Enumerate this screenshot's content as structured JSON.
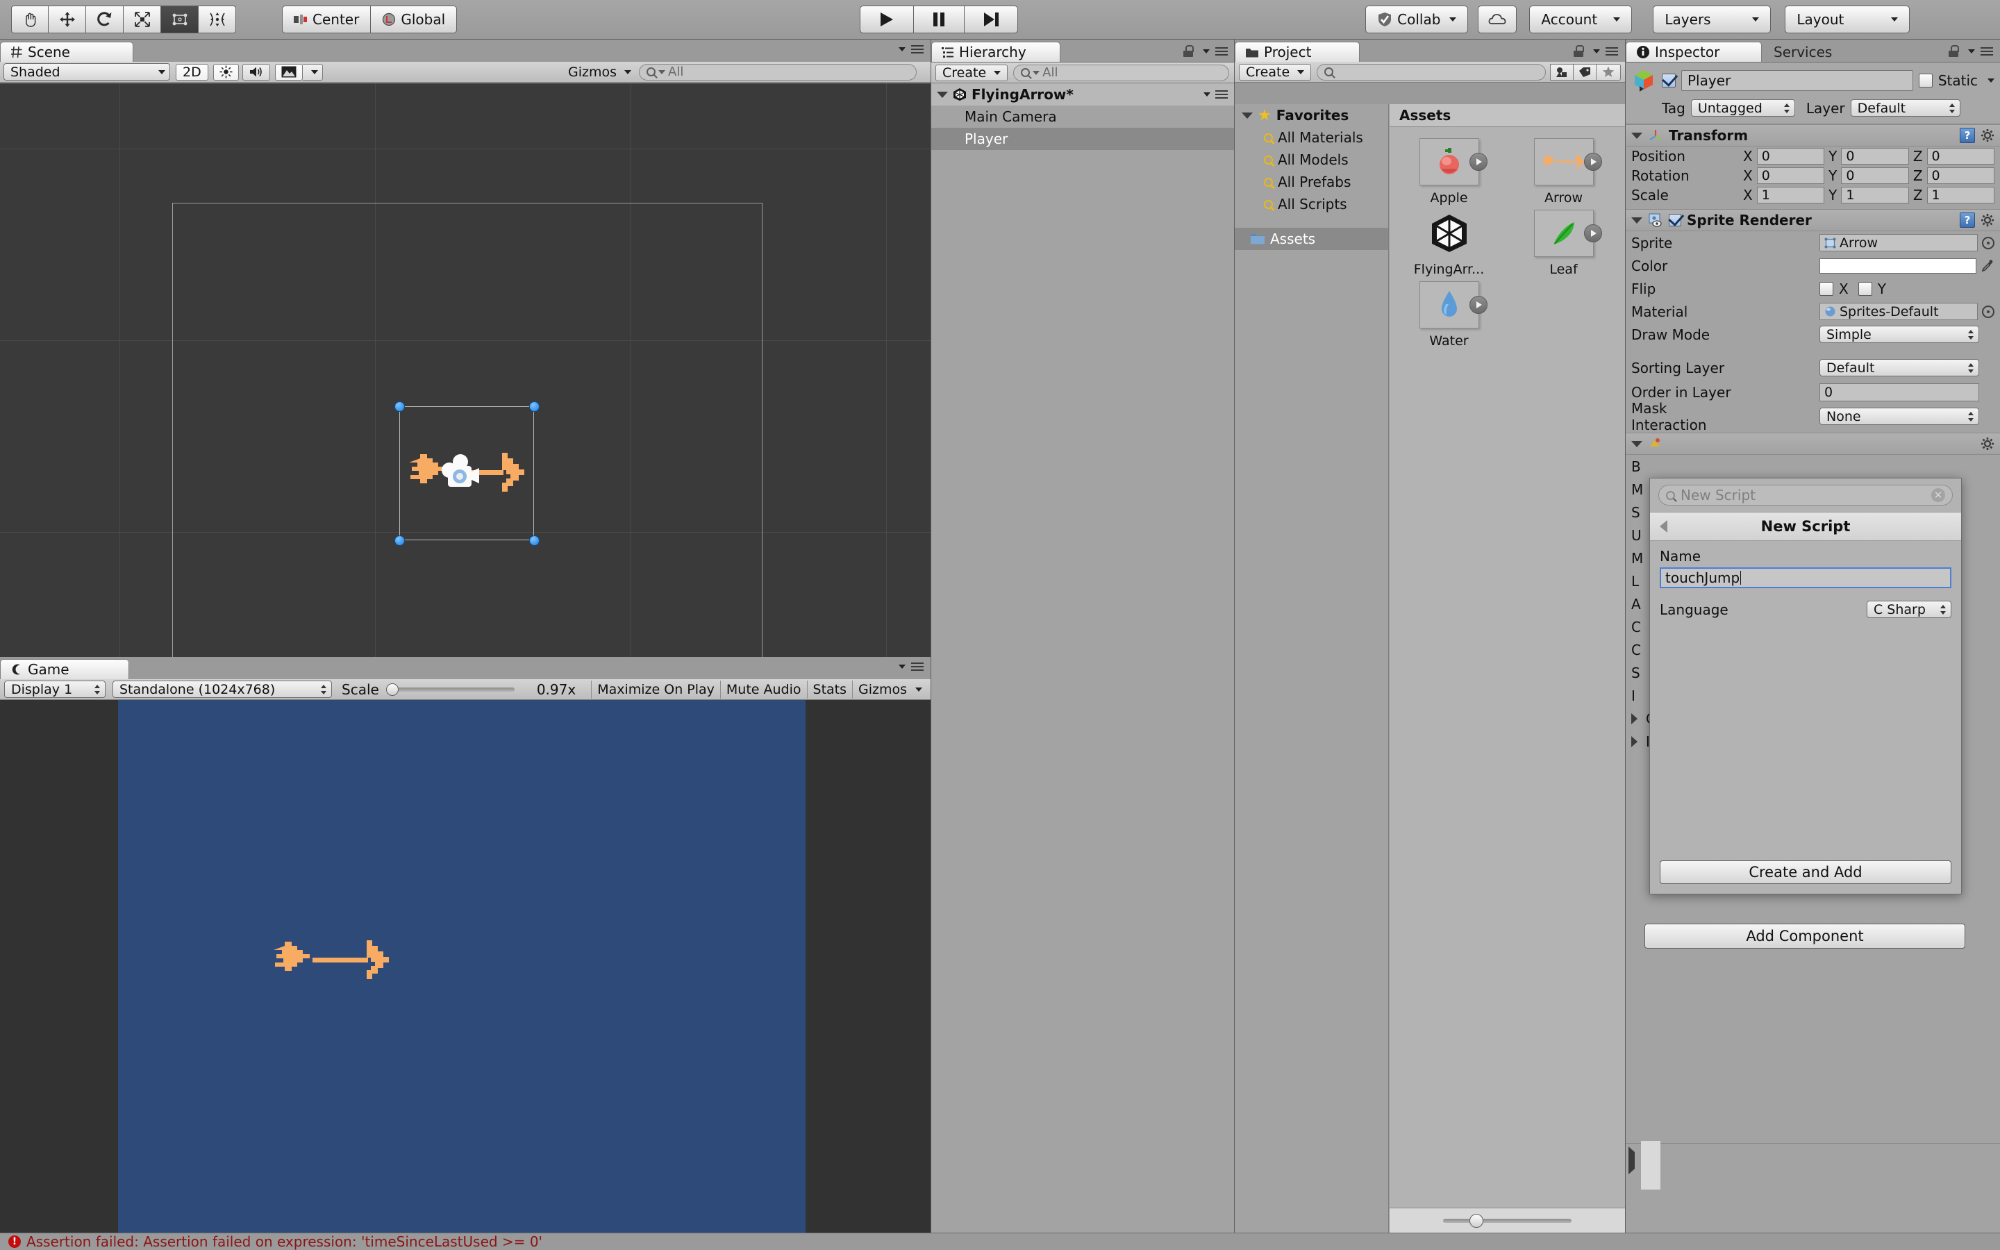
{
  "toolbar": {
    "tools": [
      {
        "name": "hand-tool",
        "label": "Hand"
      },
      {
        "name": "move-tool",
        "label": "Move"
      },
      {
        "name": "rotate-tool",
        "label": "Rotate"
      },
      {
        "name": "scale-tool",
        "label": "Scale"
      },
      {
        "name": "rect-tool",
        "label": "Rect"
      },
      {
        "name": "transform-tool",
        "label": "Transform"
      }
    ],
    "pivot_label": "Center",
    "space_label": "Global",
    "play_label": "Play",
    "pause_label": "Pause",
    "step_label": "Step",
    "collab_label": "Collab",
    "cloud_label": "Cloud",
    "account_label": "Account",
    "layers_label": "Layers",
    "layout_label": "Layout"
  },
  "scene": {
    "tab_label": "Scene",
    "shading_mode": "Shaded",
    "mode_2d": "2D",
    "gizmos_label": "Gizmos",
    "search_placeholder": "All"
  },
  "game": {
    "tab_label": "Game",
    "display": "Display 1",
    "aspect": "Standalone (1024x768)",
    "scale_label": "Scale",
    "scale_value": "0.97x",
    "maximize_label": "Maximize On Play",
    "mute_label": "Mute Audio",
    "stats_label": "Stats",
    "gizmos_label": "Gizmos"
  },
  "hierarchy": {
    "tab_label": "Hierarchy",
    "create_label": "Create",
    "search_placeholder": "All",
    "items": [
      {
        "label": "FlyingArrow*",
        "type": "scene",
        "selected": false
      },
      {
        "label": "Main Camera",
        "type": "object",
        "selected": false
      },
      {
        "label": "Player",
        "type": "object",
        "selected": true
      }
    ]
  },
  "project": {
    "tab_label": "Project",
    "create_label": "Create",
    "search_placeholder": "",
    "favorites_label": "Favorites",
    "favorites": [
      "All Materials",
      "All Models",
      "All Prefabs",
      "All Scripts"
    ],
    "assets_folder_label": "Assets",
    "assets_header": "Assets",
    "assets": [
      {
        "label": "Apple",
        "icon": "apple-sprite"
      },
      {
        "label": "Arrow",
        "icon": "arrow-sprite"
      },
      {
        "label": "FlyingArr...",
        "icon": "unity-scene"
      },
      {
        "label": "Leaf",
        "icon": "leaf-sprite"
      },
      {
        "label": "Water",
        "icon": "water-sprite"
      }
    ]
  },
  "inspector": {
    "tab_label": "Inspector",
    "services_tab_label": "Services",
    "object_name": "Player",
    "enabled": true,
    "static_label": "Static",
    "tag_label": "Tag",
    "tag_value": "Untagged",
    "layer_label": "Layer",
    "layer_value": "Default",
    "transform": {
      "title": "Transform",
      "rows": [
        {
          "label": "Position",
          "x": "0",
          "y": "0",
          "z": "0"
        },
        {
          "label": "Rotation",
          "x": "0",
          "y": "0",
          "z": "0"
        },
        {
          "label": "Scale",
          "x": "1",
          "y": "1",
          "z": "1"
        }
      ],
      "axis_labels": [
        "X",
        "Y",
        "Z"
      ]
    },
    "sprite_renderer": {
      "title": "Sprite Renderer",
      "enabled": true,
      "sprite_label": "Sprite",
      "sprite_value": "Arrow",
      "color_label": "Color",
      "color_value": "#FFFFFF",
      "flip_label": "Flip",
      "flip_x_label": "X",
      "flip_y_label": "Y",
      "material_label": "Material",
      "material_value": "Sprites-Default",
      "draw_mode_label": "Draw Mode",
      "draw_mode_value": "Simple",
      "sorting_layer_label": "Sorting Layer",
      "sorting_layer_value": "Default",
      "order_label": "Order in Layer",
      "order_value": "0",
      "mask_label": "Mask Interaction",
      "mask_value": "None"
    },
    "hidden_component_initials": [
      "B",
      "M",
      "S",
      "U",
      "M",
      "L",
      "A",
      "C",
      "C",
      "S",
      "I"
    ],
    "hidden_foldouts": [
      "C",
      "I"
    ],
    "add_component_label": "Add Component"
  },
  "new_script_popup": {
    "search_placeholder": "New Script",
    "title": "New Script",
    "name_label": "Name",
    "name_value": "touchJump",
    "language_label": "Language",
    "language_value": "C Sharp",
    "create_button_label": "Create and Add"
  },
  "status_bar": {
    "message": "Assertion failed: Assertion failed on expression: 'timeSinceLastUsed >= 0'",
    "severity": "error"
  },
  "colors": {
    "chrome": "#9a9a9a",
    "panel": "#a3a3a3",
    "scene_bg": "#3a3a3a",
    "game_bg": "#2d4a79",
    "game_letterbox": "#323232",
    "selection": "#8a8a8a",
    "handle_blue": "#1a7fe0",
    "error_red": "#8e1414",
    "arrow_orange": "#f7ab63"
  }
}
